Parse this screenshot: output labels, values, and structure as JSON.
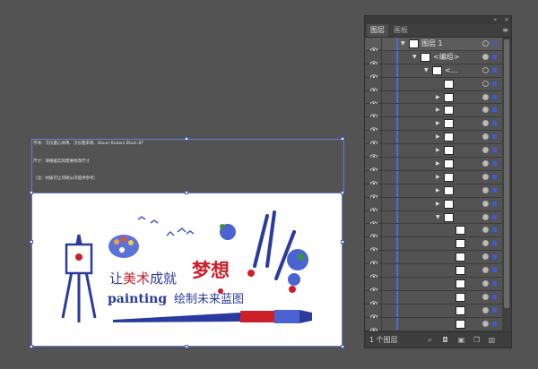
{
  "canvas": {
    "notes": [
      "字体：汉仪菱心体简、汉仪粗宋简、Bauer Bodoni Black BT",
      "尺寸：请根据实际需要修改尺寸",
      "（注：材质可让印刷公司提供参考）"
    ],
    "artwork": {
      "line1_prefix": "让",
      "line1_highlight": "美术",
      "line1_suffix": "成就",
      "line1_big": "梦想",
      "line2_latin": "painting",
      "line2_cn": "绘制未来蓝图"
    }
  },
  "panel": {
    "tabs": [
      {
        "label": "图层",
        "active": true
      },
      {
        "label": "画板",
        "active": false
      }
    ],
    "collapse_icon": "double-chevron-left-icon",
    "close_icon": "close-icon",
    "menu_icon": "panel-menu-icon",
    "layers": [
      {
        "name": "图层 1",
        "indent": 0,
        "expander": "open",
        "thumb": "logo",
        "target_filled": false,
        "selected": true
      },
      {
        "name": "<编组>",
        "indent": 1,
        "expander": "open",
        "thumb": "logo",
        "target_filled": true,
        "selected": false
      },
      {
        "name": "<...",
        "indent": 2,
        "expander": "open",
        "thumb": "logo",
        "target_filled": false,
        "selected": false
      },
      {
        "name": "",
        "indent": 3,
        "expander": "",
        "thumb": "birds",
        "target_filled": false,
        "selected": false
      },
      {
        "name": "",
        "indent": 3,
        "expander": "closed",
        "thumb": "brush",
        "target_filled": true,
        "selected": false
      },
      {
        "name": "",
        "indent": 3,
        "expander": "closed",
        "thumb": "tube",
        "target_filled": true,
        "selected": false
      },
      {
        "name": "",
        "indent": 3,
        "expander": "closed",
        "thumb": "paint-blue",
        "target_filled": true,
        "selected": false
      },
      {
        "name": "",
        "indent": 3,
        "expander": "closed",
        "thumb": "paint-green",
        "target_filled": true,
        "selected": false
      },
      {
        "name": "",
        "indent": 3,
        "expander": "closed",
        "thumb": "paint-red",
        "target_filled": true,
        "selected": false
      },
      {
        "name": "",
        "indent": 3,
        "expander": "closed",
        "thumb": "paint-orange",
        "target_filled": true,
        "selected": false
      },
      {
        "name": "",
        "indent": 3,
        "expander": "closed",
        "thumb": "palette",
        "target_filled": true,
        "selected": false
      },
      {
        "name": "",
        "indent": 3,
        "expander": "closed",
        "thumb": "stroke",
        "target_filled": true,
        "selected": false
      },
      {
        "name": "",
        "indent": 3,
        "expander": "closed",
        "thumb": "stroke",
        "target_filled": true,
        "selected": false
      },
      {
        "name": "",
        "indent": 3,
        "expander": "open",
        "thumb": "stroke",
        "target_filled": true,
        "selected": false
      },
      {
        "name": "",
        "indent": 4,
        "expander": "",
        "thumb": "blank",
        "target_filled": true,
        "selected": false
      },
      {
        "name": "",
        "indent": 4,
        "expander": "",
        "thumb": "blank",
        "target_filled": true,
        "selected": false
      },
      {
        "name": "",
        "indent": 4,
        "expander": "",
        "thumb": "blank",
        "target_filled": true,
        "selected": false
      },
      {
        "name": "",
        "indent": 4,
        "expander": "",
        "thumb": "blank",
        "target_filled": true,
        "selected": false
      },
      {
        "name": "",
        "indent": 4,
        "expander": "",
        "thumb": "stroke",
        "target_filled": true,
        "selected": false
      },
      {
        "name": "",
        "indent": 4,
        "expander": "",
        "thumb": "stroke",
        "target_filled": true,
        "selected": false
      },
      {
        "name": "",
        "indent": 4,
        "expander": "",
        "thumb": "stroke-blue",
        "target_filled": true,
        "selected": false
      },
      {
        "name": "",
        "indent": 4,
        "expander": "",
        "thumb": "stroke-blue",
        "target_filled": true,
        "selected": false
      },
      {
        "name": "",
        "indent": 3,
        "expander": "",
        "thumb": "bar",
        "target_filled": false,
        "selected": false
      }
    ],
    "footer": {
      "count_label": "1 个图层",
      "buttons": [
        "locate-object-icon",
        "make-clipping-mask-icon",
        "new-sublayer-icon",
        "new-layer-icon",
        "delete-icon"
      ]
    }
  },
  "colors": {
    "accent_blue": "#3f59d0",
    "art_blue": "#2b3a9f",
    "art_red": "#cc1f2a",
    "canvas_bg": "#535353"
  }
}
